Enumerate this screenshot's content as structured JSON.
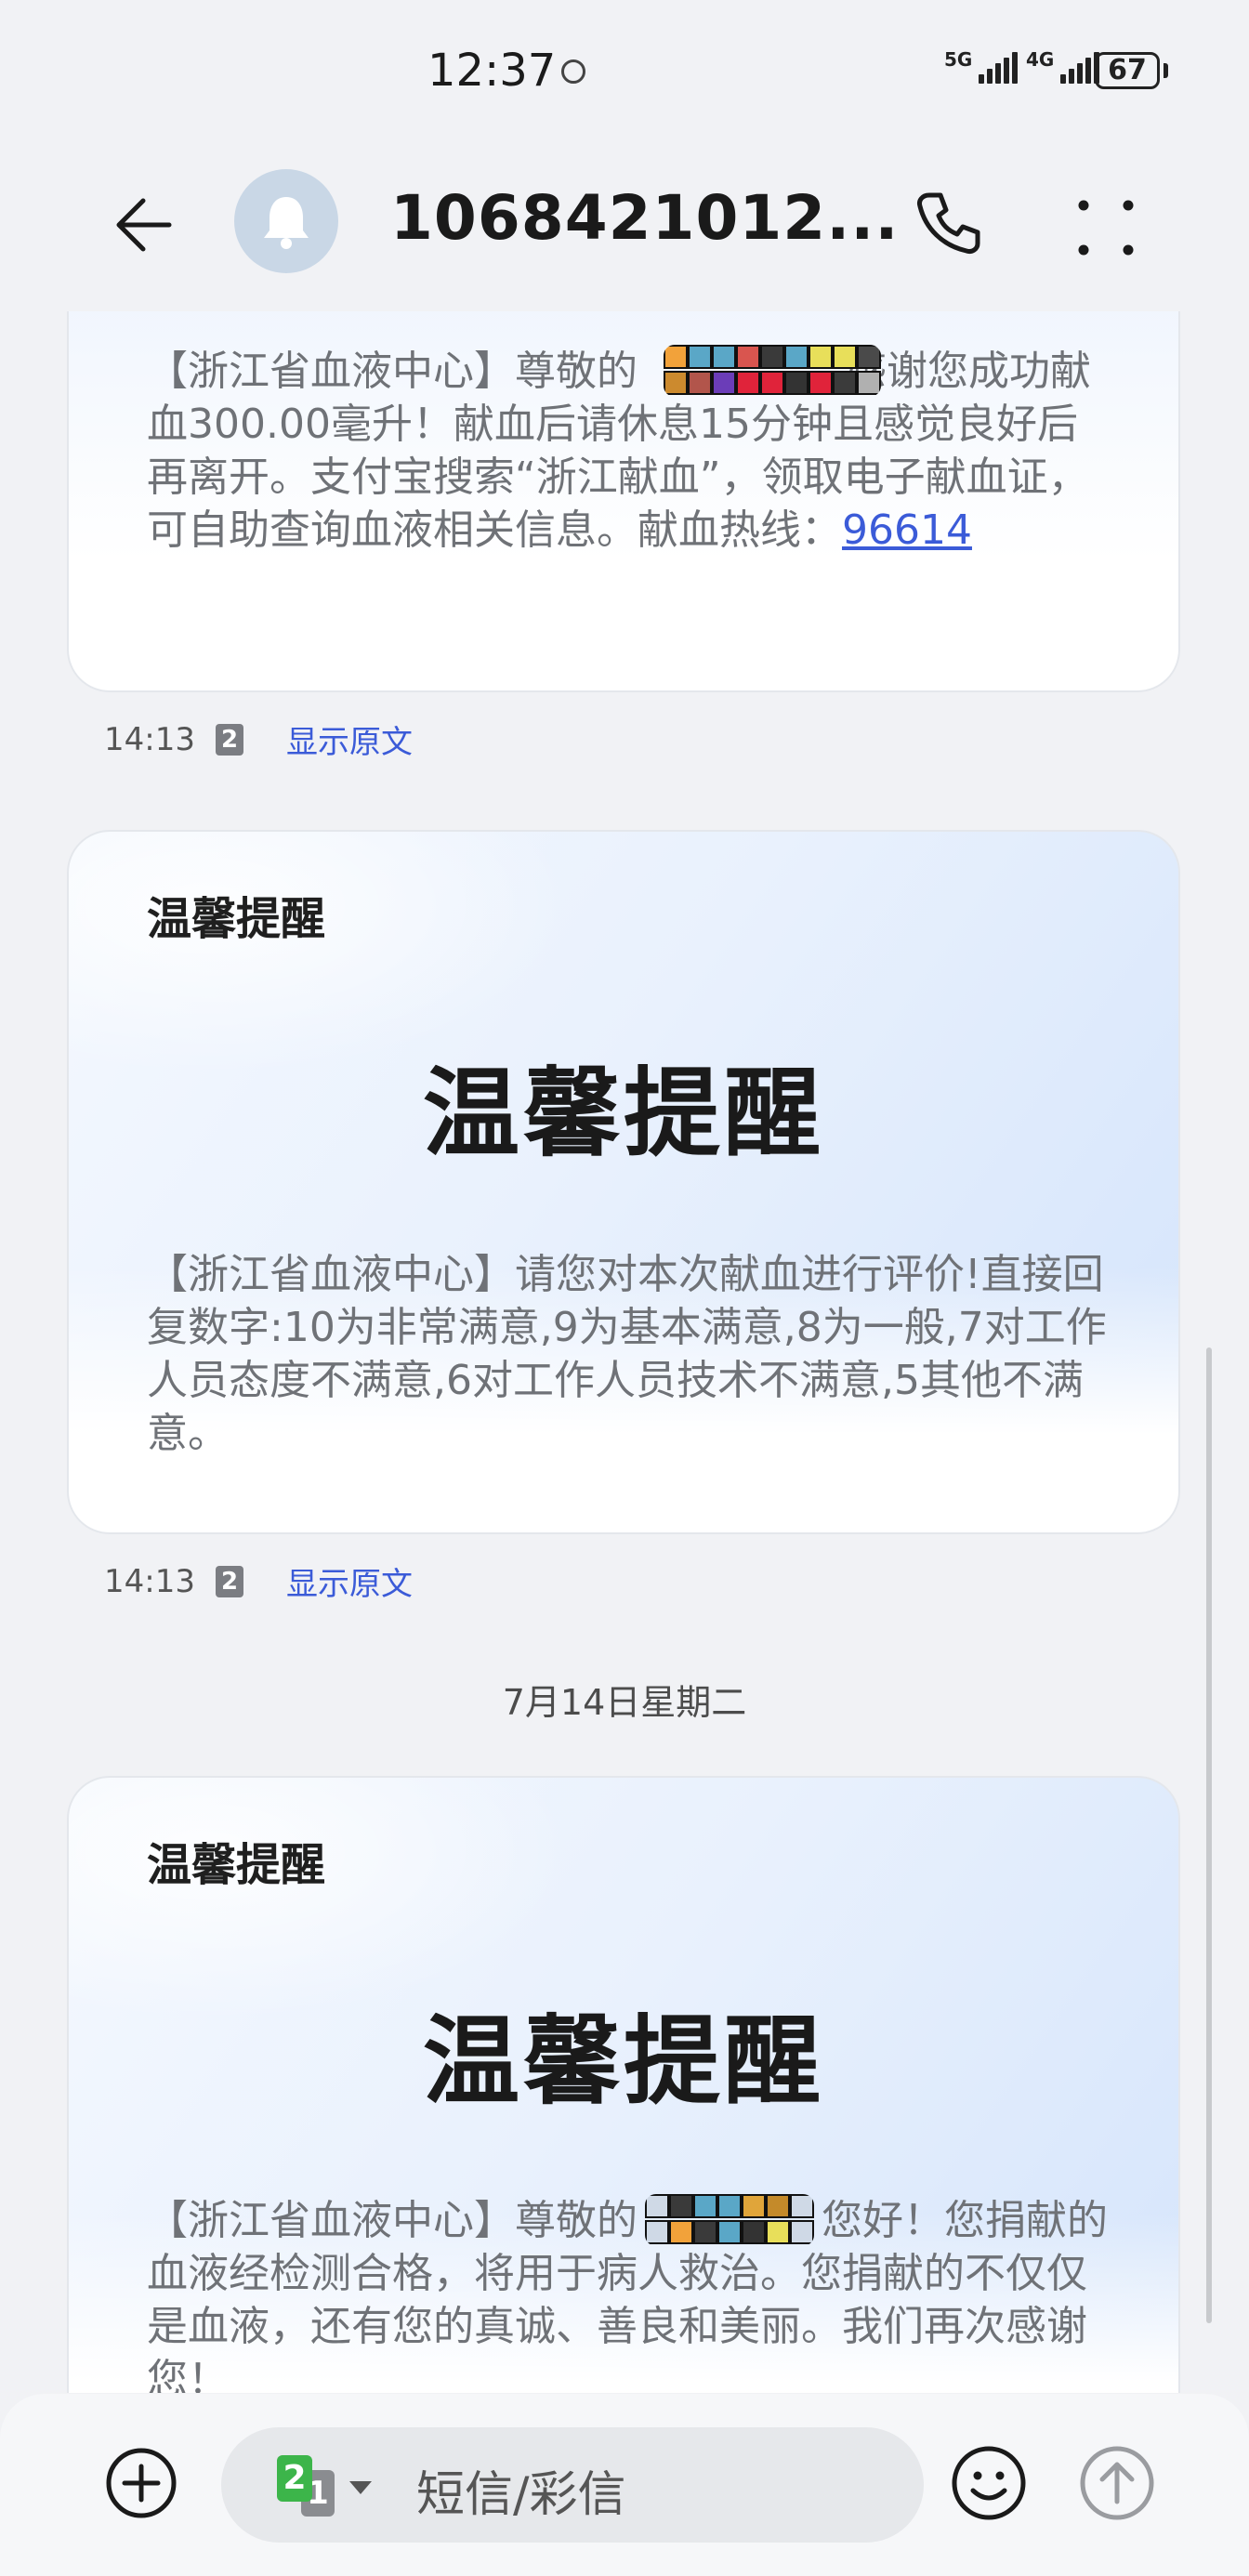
{
  "status_bar": {
    "time": "12:37",
    "sim1_network": "5G",
    "sim2_network": "4G",
    "battery": "67"
  },
  "header": {
    "sender": "1068421012..."
  },
  "messages": [
    {
      "text_before": "【浙江省血液中心】尊敬的",
      "text_after": "感谢您成功献血300.00毫升！献血后请休息15分钟且感觉良好后再离开。支付宝搜索“浙江献血”，领取电子献血证，可自助查询血液相关信息。献血热线：",
      "hotline": "96614",
      "time": "14:13",
      "sim": "2",
      "show_original": "显示原文"
    },
    {
      "label": "温馨提醒",
      "headline": "温馨提醒",
      "text": "【浙江省血液中心】请您对本次献血进行评价!直接回复数字:10为非常满意,9为基本满意,8为一般,7对工作人员态度不满意,6对工作人员技术不满意,5其他不满意。",
      "time": "14:13",
      "sim": "2",
      "show_original": "显示原文"
    },
    {
      "label": "温馨提醒",
      "headline": "温馨提醒",
      "text_before": "【浙江省血液中心】尊敬的",
      "text_after": "您好！您捐献的血液经检测合格，将用于病人救治。您捐献的不仅仅是血液，还有您的真诚、善良和美丽。我们再次感谢您！"
    }
  ],
  "date_separator": "7月14日星期二",
  "composer": {
    "placeholder": "短信/彩信",
    "sim_primary": "2",
    "sim_secondary": "1"
  },
  "colors": {
    "link": "#3b5bd8",
    "background": "#f1f2f5",
    "sim2": "#3cb54a"
  }
}
